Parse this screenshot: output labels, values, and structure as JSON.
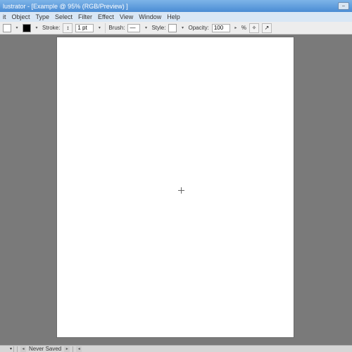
{
  "titlebar": {
    "app_fragment": "lustrator",
    "doc_title": "[Example @ 95% (RGB/Preview) ]"
  },
  "menu": {
    "items": [
      "it",
      "Object",
      "Type",
      "Select",
      "Filter",
      "Effect",
      "View",
      "Window",
      "Help"
    ]
  },
  "options": {
    "stroke_label": "Stroke:",
    "stroke_value": "1 pt",
    "brush_label": "Brush:",
    "style_label": "Style:",
    "opacity_label": "Opacity:",
    "opacity_value": "100",
    "pct": "%"
  },
  "status": {
    "save_state": "Never Saved"
  }
}
